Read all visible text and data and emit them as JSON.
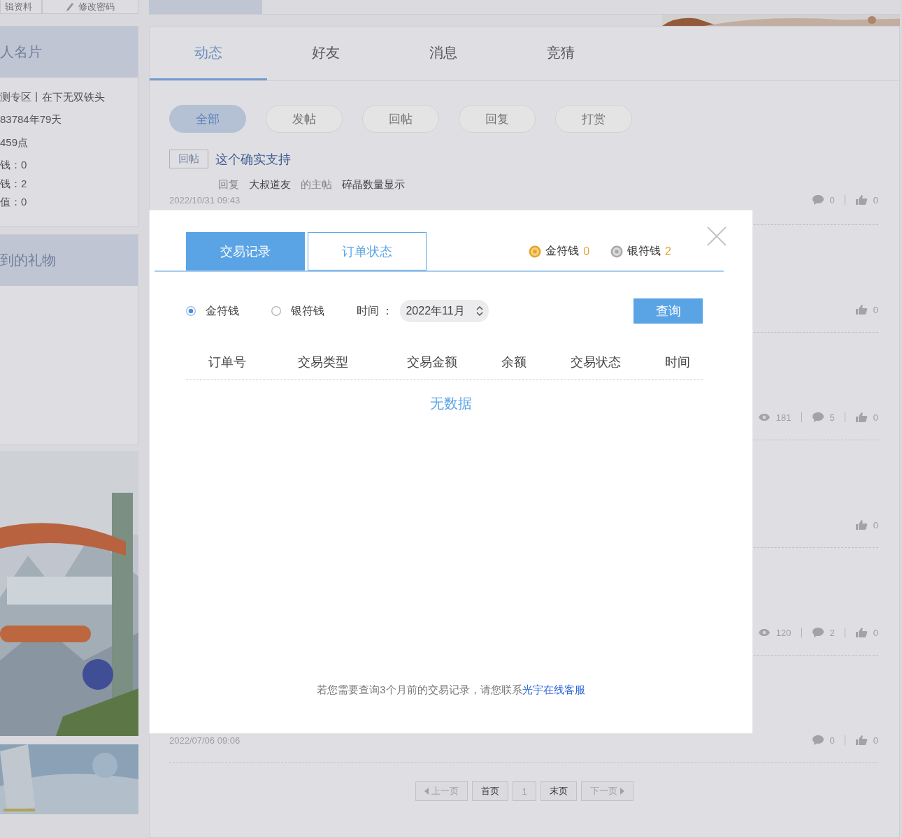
{
  "sidebar": {
    "nav": [
      {
        "label": "辑资料",
        "icon": false
      },
      {
        "label": "修改密码",
        "icon": true
      }
    ],
    "profile_card": {
      "title": "人名片",
      "lines": [
        "测专区丨在下无双铁头",
        "83784年79天",
        "459点",
        "钱：0",
        "钱：2",
        "值：0"
      ]
    },
    "gift_card": {
      "title": "到的礼物"
    }
  },
  "main": {
    "tabs": [
      {
        "label": "动态",
        "selected": true
      },
      {
        "label": "好友",
        "selected": false
      },
      {
        "label": "消息",
        "selected": false
      },
      {
        "label": "竞猜",
        "selected": false
      }
    ],
    "filters": [
      {
        "label": "全部",
        "selected": true
      },
      {
        "label": "发帖",
        "selected": false
      },
      {
        "label": "回帖",
        "selected": false
      },
      {
        "label": "回复",
        "selected": false
      },
      {
        "label": "打赏",
        "selected": false
      }
    ],
    "posts": [
      {
        "tag": "回帖",
        "title": "这个确实支持",
        "meta": [
          "回复",
          "大叔道友",
          "的主帖",
          "碎晶数量显示"
        ],
        "date": "2022/10/31 09:43",
        "comments": "0",
        "likes": "0"
      },
      {
        "likes": "0"
      },
      {
        "views": "181",
        "comments": "5",
        "likes": "0"
      },
      {
        "likes": "0"
      },
      {
        "views": "120",
        "comments": "2",
        "likes": "0"
      },
      {
        "date": "2022/07/06 09:06",
        "comments": "0",
        "likes": "0"
      }
    ],
    "pagination": [
      {
        "label": "上一页",
        "kind": "prev",
        "disabled": true
      },
      {
        "label": "首页",
        "kind": "page",
        "disabled": false
      },
      {
        "label": "1",
        "kind": "page",
        "disabled": true
      },
      {
        "label": "末页",
        "kind": "page",
        "disabled": false
      },
      {
        "label": "下一页",
        "kind": "next",
        "disabled": true
      }
    ]
  },
  "modal": {
    "tabs": [
      {
        "label": "交易记录",
        "selected": true
      },
      {
        "label": "订单状态",
        "selected": false
      }
    ],
    "balances": [
      {
        "label": "金符钱",
        "value": "0",
        "kind": "gold"
      },
      {
        "label": "银符钱",
        "value": "2",
        "kind": "silver"
      }
    ],
    "currency_options": [
      {
        "label": "金符钱",
        "selected": true
      },
      {
        "label": "银符钱",
        "selected": false
      }
    ],
    "time_label": "时间 ：",
    "month": "2022年11月",
    "query_button": "查询",
    "columns": [
      "订单号",
      "交易类型",
      "交易金额",
      "余额",
      "交易状态",
      "时间"
    ],
    "empty_text": "无数据",
    "note": "若您需要查询3个月前的交易记录，请您联系",
    "note_link": "光宇在线客服"
  }
}
